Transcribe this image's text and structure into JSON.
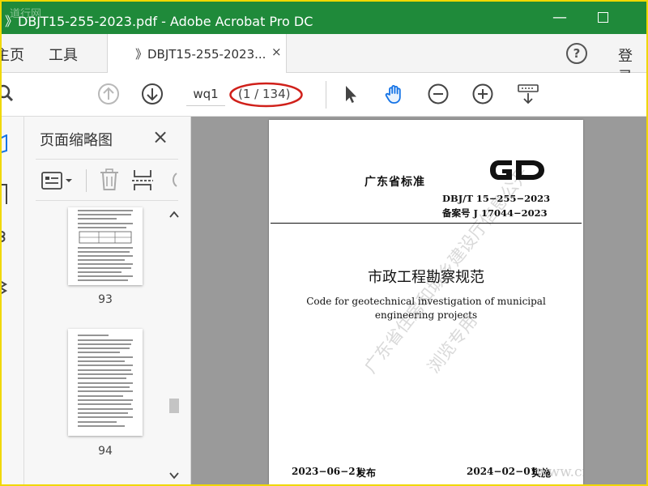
{
  "window": {
    "watermark": "道行网",
    "title": "》DBJT15-255-2023.pdf - Adobe Acrobat Pro DC",
    "minimize": "—"
  },
  "tabs": {
    "home": "主页",
    "tools": "工具",
    "doc_tab": "》DBJT15-255-2023...",
    "close": "×",
    "login": "登录"
  },
  "toolbar": {
    "page_input": "wq1",
    "page_count": "(1 / 134)"
  },
  "sidebar": {
    "title": "页面缩略图",
    "close": "×",
    "thumbnails": [
      {
        "page": "93"
      },
      {
        "page": "94"
      }
    ]
  },
  "document": {
    "org": "广东省标准",
    "code": "DBJ/T  15−255−2023",
    "record": "备案号  J 17044−2023",
    "title_cn": "市政工程勘察规范",
    "title_en_1": "Code for geotechnical investigation of municipal",
    "title_en_2": "engineering projects",
    "publish_date": "2023−06−21",
    "publish_word": "发布",
    "effective_date": "2024−02−01",
    "effective_word": "实施",
    "watermark_1": "广东省住房和城乡建设厅信息公开",
    "watermark_2": "浏览专用",
    "watermark_3": "www.cn"
  },
  "colors": {
    "titlebar": "#1f8a3a",
    "accent_red": "#d0201a",
    "frame_yellow": "#f0d800",
    "hand_tool_blue": "#1473e6"
  }
}
